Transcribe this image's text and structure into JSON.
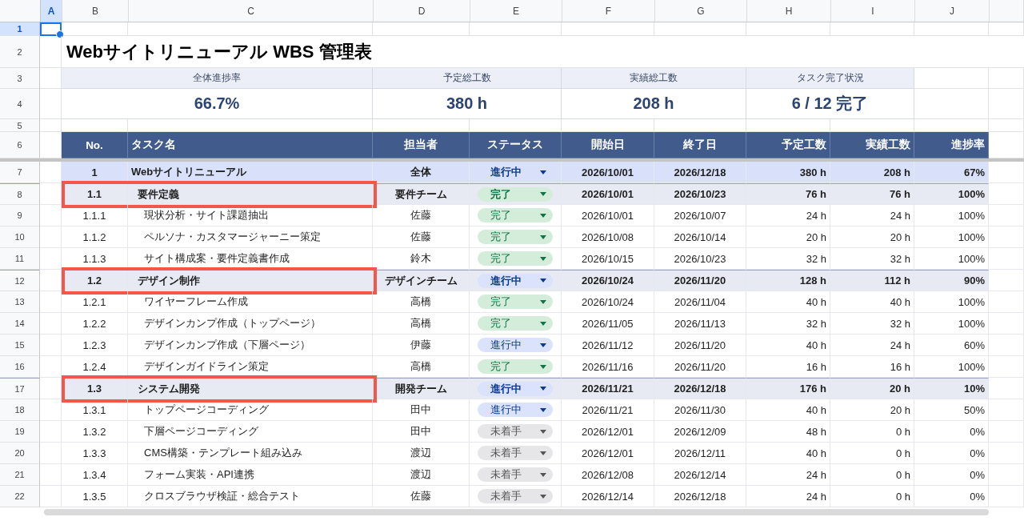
{
  "columns": [
    {
      "label": "A",
      "selected": true
    },
    {
      "label": "B",
      "selected": false
    },
    {
      "label": "C",
      "selected": false
    },
    {
      "label": "D",
      "selected": false
    },
    {
      "label": "E",
      "selected": false
    },
    {
      "label": "F",
      "selected": false
    },
    {
      "label": "G",
      "selected": false
    },
    {
      "label": "H",
      "selected": false
    },
    {
      "label": "I",
      "selected": false
    },
    {
      "label": "J",
      "selected": false
    }
  ],
  "row_numbers": [
    {
      "label": "1",
      "selected": true
    },
    {
      "label": "2",
      "selected": false
    },
    {
      "label": "3",
      "selected": false
    },
    {
      "label": "4",
      "selected": false
    },
    {
      "label": "5",
      "selected": false
    },
    {
      "label": "6",
      "selected": false
    },
    {
      "label": "7",
      "selected": false
    },
    {
      "label": "8",
      "selected": false
    },
    {
      "label": "9",
      "selected": false
    },
    {
      "label": "10",
      "selected": false
    },
    {
      "label": "11",
      "selected": false
    },
    {
      "label": "12",
      "selected": false
    },
    {
      "label": "13",
      "selected": false
    },
    {
      "label": "14",
      "selected": false
    },
    {
      "label": "15",
      "selected": false
    },
    {
      "label": "16",
      "selected": false
    },
    {
      "label": "17",
      "selected": false
    },
    {
      "label": "18",
      "selected": false
    },
    {
      "label": "19",
      "selected": false
    },
    {
      "label": "20",
      "selected": false
    },
    {
      "label": "21",
      "selected": false
    },
    {
      "label": "22",
      "selected": false
    }
  ],
  "title": "Webサイトリニューアル WBS 管理表",
  "summary": [
    {
      "label": "全体進捗率",
      "value": "66.7%"
    },
    {
      "label": "予定総工数",
      "value": "380 h"
    },
    {
      "label": "実績総工数",
      "value": "208 h"
    },
    {
      "label": "タスク完了状況",
      "value": "6 / 12 完了"
    }
  ],
  "table": {
    "columns": [
      "No.",
      "タスク名",
      "担当者",
      "ステータス",
      "開始日",
      "終了日",
      "予定工数",
      "実績工数",
      "進捗率"
    ],
    "rows": [
      {
        "kind": "total",
        "highlighted": false,
        "no": "1",
        "name": "Webサイトリニューアル",
        "assignee": "全体",
        "status": "進行中",
        "color": "#dae3fb",
        "start": "2026/10/01",
        "end": "2026/12/18",
        "planned": "380 h",
        "actual": "208 h",
        "progress": "67%"
      },
      {
        "kind": "phase",
        "highlighted": true,
        "no": "1.1",
        "name": "要件定義",
        "assignee": "要件チーム",
        "status": "完了",
        "color": "#d4edda",
        "start": "2026/10/01",
        "end": "2026/10/23",
        "planned": "76 h",
        "actual": "76 h",
        "progress": "100%"
      },
      {
        "kind": "task",
        "highlighted": false,
        "no": "1.1.1",
        "name": "現状分析・サイト課題抽出",
        "assignee": "佐藤",
        "status": "完了",
        "color": "#d4edda",
        "start": "2026/10/01",
        "end": "2026/10/07",
        "planned": "24 h",
        "actual": "24 h",
        "progress": "100%"
      },
      {
        "kind": "task",
        "highlighted": false,
        "no": "1.1.2",
        "name": "ペルソナ・カスタマージャーニー策定",
        "assignee": "佐藤",
        "status": "完了",
        "color": "#d4edda",
        "start": "2026/10/08",
        "end": "2026/10/14",
        "planned": "20 h",
        "actual": "20 h",
        "progress": "100%"
      },
      {
        "kind": "task",
        "highlighted": false,
        "no": "1.1.3",
        "name": "サイト構成案・要件定義書作成",
        "assignee": "鈴木",
        "status": "完了",
        "color": "#d4edda",
        "start": "2026/10/15",
        "end": "2026/10/23",
        "planned": "32 h",
        "actual": "32 h",
        "progress": "100%"
      },
      {
        "kind": "phase",
        "highlighted": true,
        "no": "1.2",
        "name": "デザイン制作",
        "assignee": "デザインチーム",
        "status": "進行中",
        "color": "#dae3fb",
        "start": "2026/10/24",
        "end": "2026/11/20",
        "planned": "128 h",
        "actual": "112 h",
        "progress": "90%"
      },
      {
        "kind": "task",
        "highlighted": false,
        "no": "1.2.1",
        "name": "ワイヤーフレーム作成",
        "assignee": "高橋",
        "status": "完了",
        "color": "#d4edda",
        "start": "2026/10/24",
        "end": "2026/11/04",
        "planned": "40 h",
        "actual": "40 h",
        "progress": "100%"
      },
      {
        "kind": "task",
        "highlighted": false,
        "no": "1.2.2",
        "name": "デザインカンプ作成（トップページ）",
        "assignee": "高橋",
        "status": "完了",
        "color": "#d4edda",
        "start": "2026/11/05",
        "end": "2026/11/13",
        "planned": "32 h",
        "actual": "32 h",
        "progress": "100%"
      },
      {
        "kind": "task",
        "highlighted": false,
        "no": "1.2.3",
        "name": "デザインカンプ作成（下層ページ）",
        "assignee": "伊藤",
        "status": "進行中",
        "color": "#dae3fb",
        "start": "2026/11/12",
        "end": "2026/11/20",
        "planned": "40 h",
        "actual": "24 h",
        "progress": "60%"
      },
      {
        "kind": "task",
        "highlighted": false,
        "no": "1.2.4",
        "name": "デザインガイドライン策定",
        "assignee": "高橋",
        "status": "完了",
        "color": "#d4edda",
        "start": "2026/11/16",
        "end": "2026/11/20",
        "planned": "16 h",
        "actual": "16 h",
        "progress": "100%"
      },
      {
        "kind": "phase",
        "highlighted": true,
        "no": "1.3",
        "name": "システム開発",
        "assignee": "開発チーム",
        "status": "進行中",
        "color": "#dae3fb",
        "start": "2026/11/21",
        "end": "2026/12/18",
        "planned": "176 h",
        "actual": "20 h",
        "progress": "10%"
      },
      {
        "kind": "task",
        "highlighted": false,
        "no": "1.3.1",
        "name": "トップページコーディング",
        "assignee": "田中",
        "status": "進行中",
        "color": "#dae3fb",
        "start": "2026/11/21",
        "end": "2026/11/30",
        "planned": "40 h",
        "actual": "20 h",
        "progress": "50%"
      },
      {
        "kind": "task",
        "highlighted": false,
        "no": "1.3.2",
        "name": "下層ページコーディング",
        "assignee": "田中",
        "status": "未着手",
        "color": "#e6e6e9",
        "start": "2026/12/01",
        "end": "2026/12/09",
        "planned": "48 h",
        "actual": "0 h",
        "progress": "0%"
      },
      {
        "kind": "task",
        "highlighted": false,
        "no": "1.3.3",
        "name": "CMS構築・テンプレート組み込み",
        "assignee": "渡辺",
        "status": "未着手",
        "color": "#e6e6e9",
        "start": "2026/12/01",
        "end": "2026/12/11",
        "planned": "40 h",
        "actual": "0 h",
        "progress": "0%"
      },
      {
        "kind": "task",
        "highlighted": false,
        "no": "1.3.4",
        "name": "フォーム実装・API連携",
        "assignee": "渡辺",
        "status": "未着手",
        "color": "#e6e6e9",
        "start": "2026/12/08",
        "end": "2026/12/14",
        "planned": "24 h",
        "actual": "0 h",
        "progress": "0%"
      },
      {
        "kind": "task",
        "highlighted": false,
        "no": "1.3.5",
        "name": "クロスブラウザ検証・総合テスト",
        "assignee": "佐藤",
        "status": "未着手",
        "color": "#e6e6e9",
        "start": "2026/12/14",
        "end": "2026/12/18",
        "planned": "24 h",
        "actual": "0 h",
        "progress": "0%"
      }
    ]
  }
}
